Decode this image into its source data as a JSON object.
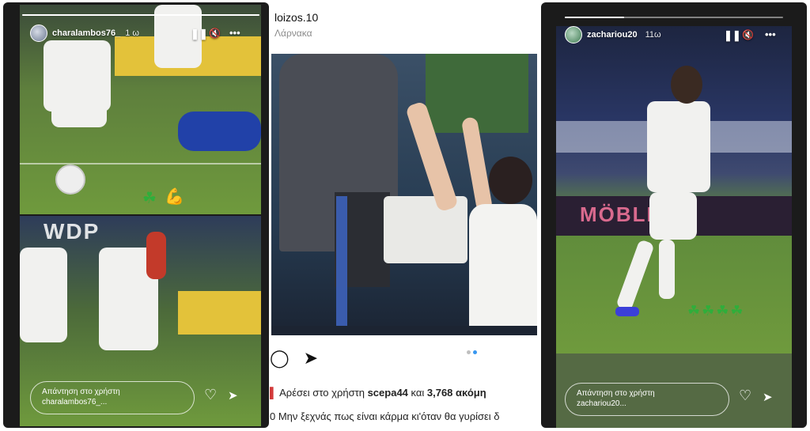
{
  "left_story": {
    "username": "charalambos76_",
    "time": "1 ω",
    "pause_icon": "pause-icon",
    "mute_icon": "mute-icon",
    "more_icon": "more-icon",
    "reply_line1": "Απάντηση στο χρήστη",
    "reply_line2": "charalambos76_...",
    "like_icon": "heart-icon",
    "send_icon": "send-icon",
    "sticker_clover": "☘",
    "sticker_flex": "💪",
    "progress_fraction": 1.0
  },
  "post": {
    "username": "loizos.10",
    "location": "Λάρνακα",
    "likes_prefix": "Αρέσει στο χρήστη ",
    "likes_user": "scepa44",
    "likes_mid": " και ",
    "likes_count": "3,768 ακόμη",
    "caption_number": "0",
    "caption_text": " Μην ξεχνάς πως είναι κάρμα κι'όταν θα γυρίσει δ",
    "comment_icon": "comment-icon",
    "share_icon": "send-icon",
    "carousel_pages": 2,
    "carousel_active": 2
  },
  "right_story": {
    "username": "zachariou20",
    "time": "11ω",
    "pause_icon": "pause-icon",
    "mute_icon": "mute-icon",
    "more_icon": "more-icon",
    "reply_line1": "Απάντηση στο χρήστη",
    "reply_line2": "zachariou20...",
    "like_icon": "heart-icon",
    "send_icon": "send-icon",
    "clovers": "☘☘☘☘",
    "progress_fraction": 0.27
  },
  "glyphs": {
    "pause": "❚❚",
    "mute": "🔇",
    "more": "•••",
    "heart": "♡",
    "send": "➤",
    "comment": "◯"
  },
  "colors": {
    "accent_blue": "#3897f0",
    "like_red": "#d23a3a",
    "clover_green": "#2fae3b"
  }
}
